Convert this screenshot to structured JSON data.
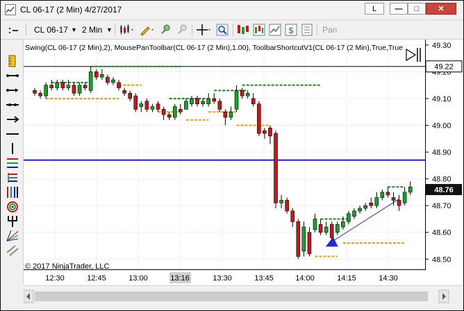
{
  "window": {
    "title": "CL 06-17 (2 Min)  4/27/2017",
    "layout_label": "L"
  },
  "toolbar": {
    "instrument": "CL 06-17",
    "interval": "2 Min",
    "pan_label": "Pan"
  },
  "chart": {
    "indicator_label": "Swing(CL 06-17 (2 Min),2), MousePanToolbar(CL 06-17 (2 Min),1.00), ToolbarShortcutV1(CL 06-17 (2 Min),True,True",
    "copyright": "© 2017 NinjaTrader, LLC",
    "price_ticks": [
      "49.30",
      "49.20",
      "49.10",
      "49.00",
      "48.90",
      "48.80",
      "48.70",
      "48.60",
      "48.50"
    ],
    "time_ticks": [
      "12:30",
      "12:45",
      "13:00",
      "13:16",
      "13:30",
      "13:45",
      "14:00",
      "14:15",
      "14:30"
    ],
    "highlighted_time": "13:16",
    "current_price": "48.76",
    "line_price": "49.22",
    "horizontal_line_price": 48.87,
    "colors": {
      "up": "#1e9e2e",
      "down": "#c8171b",
      "swing_high": "#138a13",
      "swing_low": "#e0a000",
      "hline": "#1020c0",
      "cursor_line": "#000000",
      "arrow": "#2030d0"
    }
  },
  "chart_data": {
    "type": "candlestick",
    "instrument": "CL 06-17",
    "interval": "2 Min",
    "ylim": [
      48.48,
      49.31
    ],
    "x_ticks": [
      "12:30",
      "12:45",
      "13:00",
      "13:16",
      "13:30",
      "13:45",
      "14:00",
      "14:15",
      "14:30"
    ],
    "candles": [
      {
        "o": 49.13,
        "c": 49.12,
        "h": 49.14,
        "l": 49.11
      },
      {
        "o": 49.12,
        "c": 49.11,
        "h": 49.13,
        "l": 49.1
      },
      {
        "o": 49.11,
        "c": 49.15,
        "h": 49.16,
        "l": 49.1
      },
      {
        "o": 49.15,
        "c": 49.14,
        "h": 49.17,
        "l": 49.13
      },
      {
        "o": 49.14,
        "c": 49.16,
        "h": 49.17,
        "l": 49.13
      },
      {
        "o": 49.16,
        "c": 49.14,
        "h": 49.17,
        "l": 49.13
      },
      {
        "o": 49.14,
        "c": 49.15,
        "h": 49.17,
        "l": 49.13
      },
      {
        "o": 49.15,
        "c": 49.12,
        "h": 49.16,
        "l": 49.11
      },
      {
        "o": 49.12,
        "c": 49.15,
        "h": 49.16,
        "l": 49.11
      },
      {
        "o": 49.15,
        "c": 49.14,
        "h": 49.16,
        "l": 49.13
      },
      {
        "o": 49.13,
        "c": 49.2,
        "h": 49.22,
        "l": 49.12
      },
      {
        "o": 49.2,
        "c": 49.18,
        "h": 49.21,
        "l": 49.17
      },
      {
        "o": 49.18,
        "c": 49.19,
        "h": 49.21,
        "l": 49.17
      },
      {
        "o": 49.18,
        "c": 49.16,
        "h": 49.19,
        "l": 49.15
      },
      {
        "o": 49.16,
        "c": 49.17,
        "h": 49.18,
        "l": 49.15
      },
      {
        "o": 49.16,
        "c": 49.14,
        "h": 49.17,
        "l": 49.13
      },
      {
        "o": 49.13,
        "c": 49.12,
        "h": 49.14,
        "l": 49.11
      },
      {
        "o": 49.12,
        "c": 49.1,
        "h": 49.13,
        "l": 49.09
      },
      {
        "o": 49.11,
        "c": 49.06,
        "h": 49.12,
        "l": 49.05
      },
      {
        "o": 49.07,
        "c": 49.08,
        "h": 49.09,
        "l": 49.05
      },
      {
        "o": 49.09,
        "c": 49.06,
        "h": 49.1,
        "l": 49.05
      },
      {
        "o": 49.06,
        "c": 49.07,
        "h": 49.08,
        "l": 49.05
      },
      {
        "o": 49.08,
        "c": 49.06,
        "h": 49.09,
        "l": 49.05
      },
      {
        "o": 49.06,
        "c": 49.04,
        "h": 49.07,
        "l": 49.02
      },
      {
        "o": 49.04,
        "c": 49.03,
        "h": 49.05,
        "l": 49.02
      },
      {
        "o": 49.03,
        "c": 49.07,
        "h": 49.08,
        "l": 49.02
      },
      {
        "o": 49.06,
        "c": 49.05,
        "h": 49.08,
        "l": 49.04
      },
      {
        "o": 49.06,
        "c": 49.09,
        "h": 49.1,
        "l": 49.06
      },
      {
        "o": 49.08,
        "c": 49.1,
        "h": 49.11,
        "l": 49.07
      },
      {
        "o": 49.1,
        "c": 49.08,
        "h": 49.11,
        "l": 49.07
      },
      {
        "o": 49.08,
        "c": 49.09,
        "h": 49.1,
        "l": 49.07
      },
      {
        "o": 49.08,
        "c": 49.1,
        "h": 49.12,
        "l": 49.07
      },
      {
        "o": 49.1,
        "c": 49.09,
        "h": 49.12,
        "l": 49.08
      },
      {
        "o": 49.09,
        "c": 49.06,
        "h": 49.1,
        "l": 49.05
      },
      {
        "o": 49.05,
        "c": 49.03,
        "h": 49.06,
        "l": 49.0
      },
      {
        "o": 49.03,
        "c": 49.05,
        "h": 49.07,
        "l": 49.02
      },
      {
        "o": 49.06,
        "c": 49.13,
        "h": 49.15,
        "l": 49.05
      },
      {
        "o": 49.13,
        "c": 49.11,
        "h": 49.14,
        "l": 49.1
      },
      {
        "o": 49.11,
        "c": 49.12,
        "h": 49.13,
        "l": 49.1
      },
      {
        "o": 49.1,
        "c": 49.08,
        "h": 49.12,
        "l": 49.07
      },
      {
        "o": 49.08,
        "c": 48.97,
        "h": 49.09,
        "l": 48.96
      },
      {
        "o": 48.98,
        "c": 48.97,
        "h": 48.99,
        "l": 48.95
      },
      {
        "o": 48.99,
        "c": 48.96,
        "h": 49.0,
        "l": 48.93
      },
      {
        "o": 48.97,
        "c": 48.71,
        "h": 48.98,
        "l": 48.69
      },
      {
        "o": 48.71,
        "c": 48.72,
        "h": 48.74,
        "l": 48.69
      },
      {
        "o": 48.72,
        "c": 48.68,
        "h": 48.73,
        "l": 48.67
      },
      {
        "o": 48.68,
        "c": 48.64,
        "h": 48.69,
        "l": 48.62
      },
      {
        "o": 48.64,
        "c": 48.51,
        "h": 48.65,
        "l": 48.5
      },
      {
        "o": 48.53,
        "c": 48.62,
        "h": 48.64,
        "l": 48.51
      },
      {
        "o": 48.6,
        "c": 48.52,
        "h": 48.62,
        "l": 48.51
      },
      {
        "o": 48.61,
        "c": 48.65,
        "h": 48.67,
        "l": 48.6
      },
      {
        "o": 48.63,
        "c": 48.6,
        "h": 48.65,
        "l": 48.59
      },
      {
        "o": 48.6,
        "c": 48.62,
        "h": 48.64,
        "l": 48.59
      },
      {
        "o": 48.63,
        "c": 48.58,
        "h": 48.64,
        "l": 48.57
      },
      {
        "o": 48.6,
        "c": 48.63,
        "h": 48.64,
        "l": 48.59
      },
      {
        "o": 48.62,
        "c": 48.64,
        "h": 48.66,
        "l": 48.61
      },
      {
        "o": 48.64,
        "c": 48.67,
        "h": 48.68,
        "l": 48.63
      },
      {
        "o": 48.66,
        "c": 48.68,
        "h": 48.69,
        "l": 48.65
      },
      {
        "o": 48.68,
        "c": 48.69,
        "h": 48.7,
        "l": 48.67
      },
      {
        "o": 48.69,
        "c": 48.7,
        "h": 48.71,
        "l": 48.68
      },
      {
        "o": 48.71,
        "c": 48.7,
        "h": 48.73,
        "l": 48.69
      },
      {
        "o": 48.7,
        "c": 48.73,
        "h": 48.75,
        "l": 48.69
      },
      {
        "o": 48.73,
        "c": 48.75,
        "h": 48.76,
        "l": 48.72
      },
      {
        "o": 48.75,
        "c": 48.74,
        "h": 48.77,
        "l": 48.73
      },
      {
        "o": 48.73,
        "c": 48.72,
        "h": 48.75,
        "l": 48.7
      },
      {
        "o": 48.72,
        "c": 48.7,
        "h": 48.74,
        "l": 48.68
      },
      {
        "o": 48.71,
        "c": 48.75,
        "h": 48.77,
        "l": 48.7
      },
      {
        "o": 48.75,
        "c": 48.77,
        "h": 48.79,
        "l": 48.74
      }
    ],
    "swing_highs": [
      {
        "price": 49.16,
        "from": 3,
        "to": 10
      },
      {
        "price": 49.22,
        "from": 10,
        "to": 26
      },
      {
        "price": 49.1,
        "from": 24,
        "to": 31
      },
      {
        "price": 49.13,
        "from": 32,
        "to": 38
      },
      {
        "price": 49.15,
        "from": 37,
        "to": 51
      },
      {
        "price": 48.65,
        "from": 51,
        "to": 56
      },
      {
        "price": 48.77,
        "from": 63,
        "to": 66
      }
    ],
    "swing_lows": [
      {
        "price": 49.1,
        "from": 2,
        "to": 15
      },
      {
        "price": 49.15,
        "from": 15,
        "to": 19
      },
      {
        "price": 49.05,
        "from": 22,
        "to": 26
      },
      {
        "price": 49.02,
        "from": 27,
        "to": 31
      },
      {
        "price": 49.05,
        "from": 31,
        "to": 36
      },
      {
        "price": 49.0,
        "from": 36,
        "to": 42
      },
      {
        "price": 48.51,
        "from": 50,
        "to": 54
      },
      {
        "price": 48.56,
        "from": 55,
        "to": 66
      }
    ],
    "horizontal_line": 48.87,
    "ray_line": 49.22,
    "trend_arrow": {
      "from_bar": 53,
      "from_price": 48.565,
      "to_bar": 65,
      "to_price": 48.725
    }
  }
}
